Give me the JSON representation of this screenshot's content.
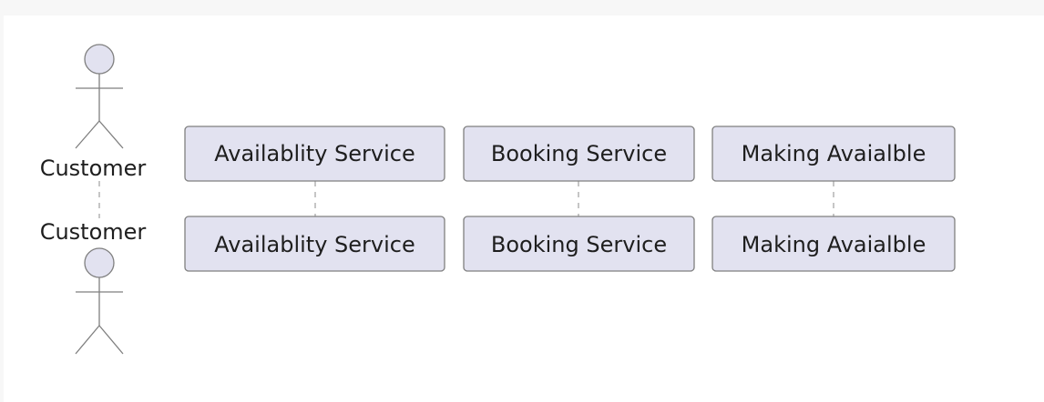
{
  "diagram": {
    "type": "sequence",
    "participants": [
      {
        "id": "customer",
        "kind": "actor",
        "label_top": "Customer",
        "label_bottom": "Customer"
      },
      {
        "id": "availability",
        "kind": "participant",
        "label_top": "Availablity Service",
        "label_bottom": "Availablity Service"
      },
      {
        "id": "booking",
        "kind": "participant",
        "label_top": "Booking Service",
        "label_bottom": "Booking Service"
      },
      {
        "id": "making",
        "kind": "participant",
        "label_top": "Making Avaialble",
        "label_bottom": "Making Avaialble"
      }
    ]
  },
  "colors": {
    "box_fill": "#e2e2f0",
    "border": "#7f7f7f",
    "lifeline": "#a0a0a0",
    "text": "#1e1e1e"
  }
}
